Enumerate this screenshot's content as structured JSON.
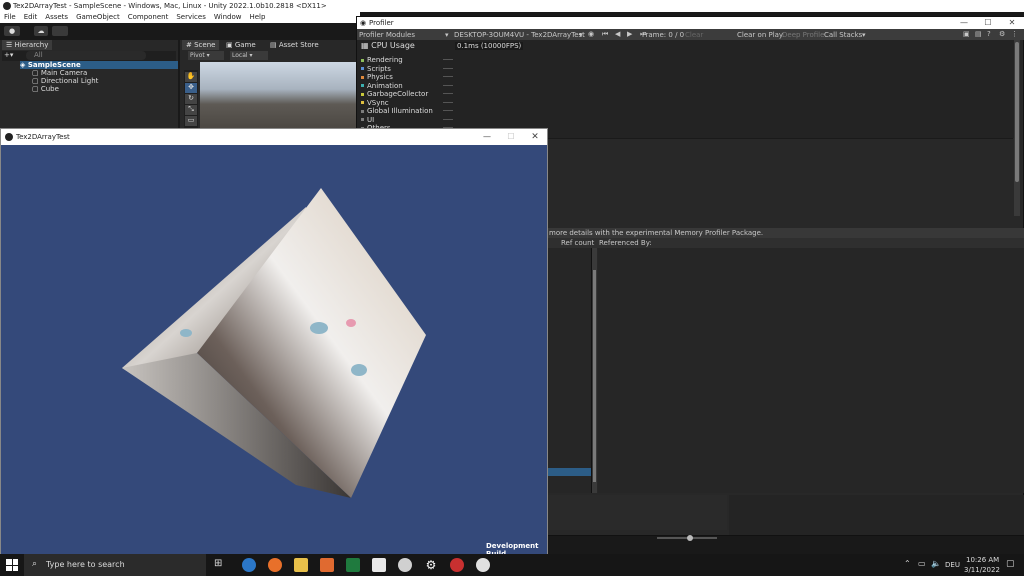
{
  "window": {
    "title": "Tex2DArrayTest - SampleScene - Windows, Mac, Linux - Unity 2022.1.0b10.2818 <DX11>"
  },
  "menubar": [
    "File",
    "Edit",
    "Assets",
    "GameObject",
    "Component",
    "Services",
    "Window",
    "Help"
  ],
  "hierarchy": {
    "tab": "Hierarchy",
    "search_placeholder": "All",
    "scene": "SampleScene",
    "items": [
      "Main Camera",
      "Directional Light",
      "Cube"
    ]
  },
  "scene_tabs": {
    "scene": "Scene",
    "game": "Game",
    "asset_store": "Asset Store",
    "pivot": "Pivot",
    "local": "Local"
  },
  "profiler": {
    "title": "Profiler",
    "modules_label": "Profiler Modules",
    "target": "DESKTOP-3OUM4VU - Tex2DArrayTest",
    "frame": "Frame: 0 / 0",
    "clear": "Clear",
    "clear_on_play": "Clear on Play",
    "deep_profile": "Deep Profile",
    "call_stacks": "Call Stacks",
    "cpu_label": "CPU Usage",
    "cpu_value": "0.1ms (10000FPS)",
    "modules": [
      {
        "label": "Rendering",
        "color": "#8fbf5a"
      },
      {
        "label": "Scripts",
        "color": "#5a8fd6"
      },
      {
        "label": "Physics",
        "color": "#e08a3c"
      },
      {
        "label": "Animation",
        "color": "#3cb0b0"
      },
      {
        "label": "GarbageCollector",
        "color": "#c8c83c"
      },
      {
        "label": "VSync",
        "color": "#e0c040"
      },
      {
        "label": "Global Illumination",
        "color": "#7c7c7c"
      },
      {
        "label": "UI",
        "color": "#7c7c7c"
      },
      {
        "label": "Others",
        "color": "#7c7c7c"
      }
    ],
    "memory_note": "more details with the experimental Memory Profiler Package.",
    "ref_count": "Ref count",
    "referenced_by": "Referenced By:"
  },
  "game_window": {
    "title": "Tex2DArrayTest",
    "dev_build": "Development Build"
  },
  "taskbar": {
    "search_placeholder": "Type here to search",
    "lang": "DEU",
    "time": "10:26 AM",
    "date": "3/11/2022"
  }
}
